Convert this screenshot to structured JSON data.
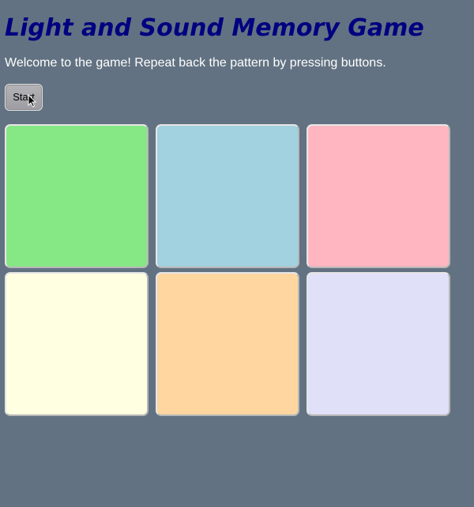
{
  "header": {
    "title": "Light and Sound Memory Game"
  },
  "intro": {
    "text": "Welcome to the game! Repeat back the pattern by pressing buttons."
  },
  "controls": {
    "start_label": "Start"
  },
  "game_buttons": [
    {
      "color": "#86e884"
    },
    {
      "color": "#a2d1e0"
    },
    {
      "color": "#ffb6c1"
    },
    {
      "color": "#ffffe2"
    },
    {
      "color": "#ffd6a0"
    },
    {
      "color": "#e0e0f8"
    }
  ],
  "colors": {
    "background": "#627282",
    "title": "#000080",
    "intro_text": "#ffffff"
  },
  "icons": {
    "cursor": "pointer-cursor-icon"
  }
}
